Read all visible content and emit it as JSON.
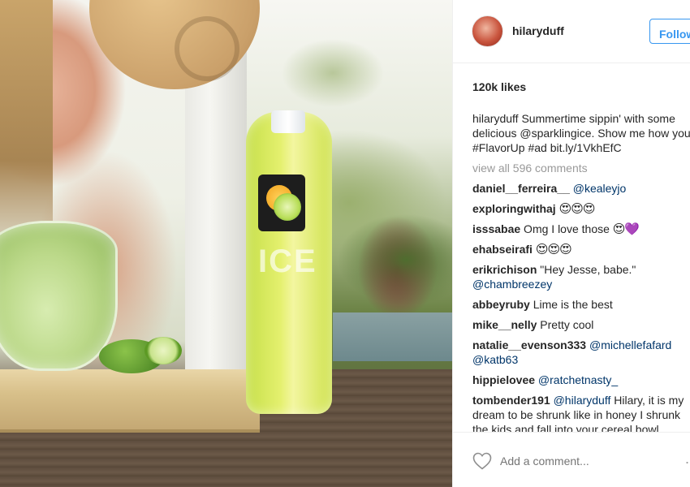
{
  "post": {
    "username": "hilaryduff",
    "follow_label": "Follow",
    "likes": "120k likes",
    "caption": {
      "username": "hilaryduff",
      "text_before": " Summertime sippin' with some delicious ",
      "mention": "@sparklingice",
      "text_mid": ". Show me how you ",
      "hashtag1": "#FlavorUp",
      "space": " ",
      "hashtag2": "#ad",
      "link": " bit.ly/1VkhEfC"
    },
    "view_all_comments": "view all 596 comments",
    "comments": [
      {
        "user": "daniel__ferreira__",
        "text": "",
        "mention": "@kealeyjo",
        "emoji": ""
      },
      {
        "user": "exploringwithaj",
        "text": "",
        "mention": "",
        "emoji": "😍😍😍"
      },
      {
        "user": "isssabae",
        "text": " Omg I love those ",
        "mention": "",
        "emoji": "😍💜"
      },
      {
        "user": "ehabseirafi",
        "text": "",
        "mention": "",
        "emoji": "😍😍😍"
      },
      {
        "user": "erikrichison",
        "text": " \"Hey Jesse, babe.\" ",
        "mention": "@chambreezey",
        "emoji": ""
      },
      {
        "user": "abbeyruby",
        "text": " Lime is the best",
        "mention": "",
        "emoji": ""
      },
      {
        "user": "mike__nelly",
        "text": " Pretty cool",
        "mention": "",
        "emoji": ""
      },
      {
        "user": "natalie__evenson333",
        "text": " ",
        "mention": "@michellefafard",
        "mention2": "@katb63",
        "emoji": ""
      },
      {
        "user": "hippielovee",
        "text": " ",
        "mention": "@ratchetnasty_",
        "emoji": ""
      },
      {
        "user": "tombender191",
        "text": "",
        "mention": "@hilaryduff",
        "tail": " Hilary, it is my dream to be shrunk like in honey I shrunk the kids and fall into your cereal bowl",
        "emoji": ""
      }
    ],
    "add_comment_placeholder": "Add a comment...",
    "more_options": "..."
  },
  "icons": {
    "heart": "heart-icon",
    "more": "more-options-icon"
  },
  "colors": {
    "link": "#003569",
    "follow_blue": "#3897f0",
    "muted": "#999999",
    "text": "#262626"
  },
  "photo": {
    "bottle_brand": "ICE"
  }
}
